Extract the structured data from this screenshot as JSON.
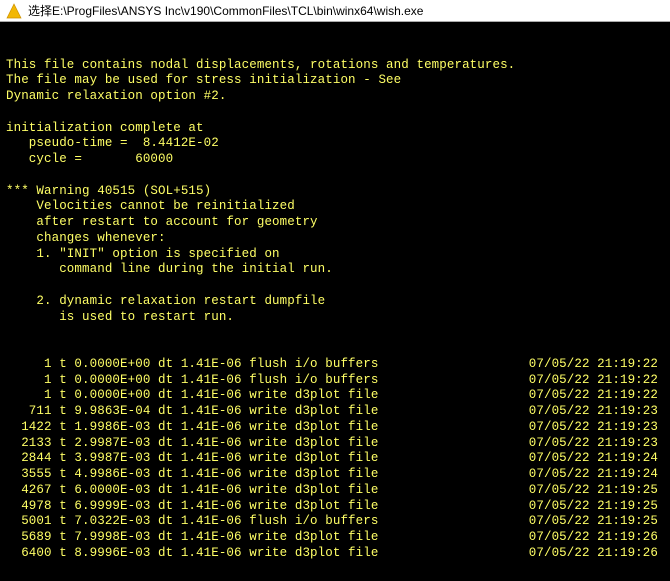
{
  "title": "选择E:\\ProgFiles\\ANSYS Inc\\v190\\CommonFiles\\TCL\\bin\\winx64\\wish.exe",
  "header_lines": [
    "This file contains nodal displacements, rotations and temperatures.",
    "The file may be used for stress initialization - See",
    "Dynamic relaxation option #2.",
    "",
    "initialization complete at",
    "   pseudo-time =  8.4412E-02",
    "   cycle =       60000",
    "",
    "*** Warning 40515 (SOL+515)",
    "    Velocities cannot be reinitialized",
    "    after restart to account for geometry",
    "    changes whenever:",
    "    1. \"INIT\" option is specified on",
    "       command line during the initial run.",
    "",
    "    2. dynamic relaxation restart dumpfile",
    "       is used to restart run."
  ],
  "log_rows": [
    {
      "cycle": "1",
      "t": "0.0000E+00",
      "dt": "1.41E-06",
      "action": "flush i/o buffers",
      "ts": "07/05/22 21:19:22"
    },
    {
      "cycle": "1",
      "t": "0.0000E+00",
      "dt": "1.41E-06",
      "action": "flush i/o buffers",
      "ts": "07/05/22 21:19:22"
    },
    {
      "cycle": "1",
      "t": "0.0000E+00",
      "dt": "1.41E-06",
      "action": "write d3plot file",
      "ts": "07/05/22 21:19:22"
    },
    {
      "cycle": "711",
      "t": "9.9863E-04",
      "dt": "1.41E-06",
      "action": "write d3plot file",
      "ts": "07/05/22 21:19:23"
    },
    {
      "cycle": "1422",
      "t": "1.9986E-03",
      "dt": "1.41E-06",
      "action": "write d3plot file",
      "ts": "07/05/22 21:19:23"
    },
    {
      "cycle": "2133",
      "t": "2.9987E-03",
      "dt": "1.41E-06",
      "action": "write d3plot file",
      "ts": "07/05/22 21:19:23"
    },
    {
      "cycle": "2844",
      "t": "3.9987E-03",
      "dt": "1.41E-06",
      "action": "write d3plot file",
      "ts": "07/05/22 21:19:24"
    },
    {
      "cycle": "3555",
      "t": "4.9986E-03",
      "dt": "1.41E-06",
      "action": "write d3plot file",
      "ts": "07/05/22 21:19:24"
    },
    {
      "cycle": "4267",
      "t": "6.0000E-03",
      "dt": "1.41E-06",
      "action": "write d3plot file",
      "ts": "07/05/22 21:19:25"
    },
    {
      "cycle": "4978",
      "t": "6.9999E-03",
      "dt": "1.41E-06",
      "action": "write d3plot file",
      "ts": "07/05/22 21:19:25"
    },
    {
      "cycle": "5001",
      "t": "7.0322E-03",
      "dt": "1.41E-06",
      "action": "flush i/o buffers",
      "ts": "07/05/22 21:19:25"
    },
    {
      "cycle": "5689",
      "t": "7.9998E-03",
      "dt": "1.41E-06",
      "action": "write d3plot file",
      "ts": "07/05/22 21:19:26"
    },
    {
      "cycle": "6400",
      "t": "8.9996E-03",
      "dt": "1.41E-06",
      "action": "write d3plot file",
      "ts": "07/05/22 21:19:26"
    }
  ]
}
